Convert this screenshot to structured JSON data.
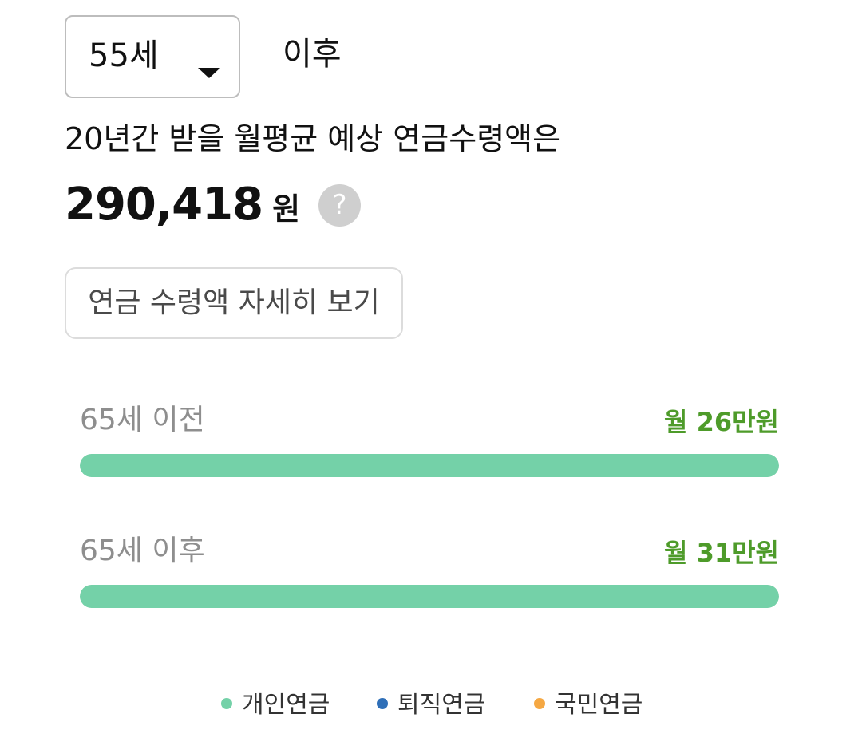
{
  "selector": {
    "age_value": "55세",
    "after_label": "이후"
  },
  "summary": {
    "description": "20년간 받을 월평균 예상 연금수령액은",
    "amount": "290,418",
    "unit": "원",
    "help_glyph": "?"
  },
  "detail_button": {
    "label": "연금 수령액 자세히 보기"
  },
  "bars": [
    {
      "label": "65세 이전",
      "value_text": "월 26만원",
      "segments": [
        {
          "type": "personal",
          "fraction": 1.0
        }
      ]
    },
    {
      "label": "65세 이후",
      "value_text": "월 31만원",
      "segments": [
        {
          "type": "personal",
          "fraction": 1.0
        }
      ]
    }
  ],
  "legend": [
    {
      "label": "개인연금",
      "color": "#74d1a8"
    },
    {
      "label": "퇴직연금",
      "color": "#2f6fb8"
    },
    {
      "label": "국민연금",
      "color": "#f5a843"
    }
  ],
  "colors": {
    "personal": "#74d1a8",
    "retirement": "#2f6fb8",
    "national": "#f5a843",
    "value_text": "#4e9b2a"
  },
  "icons": {
    "help": "question-circle-icon",
    "dropdown": "caret-down-icon"
  }
}
